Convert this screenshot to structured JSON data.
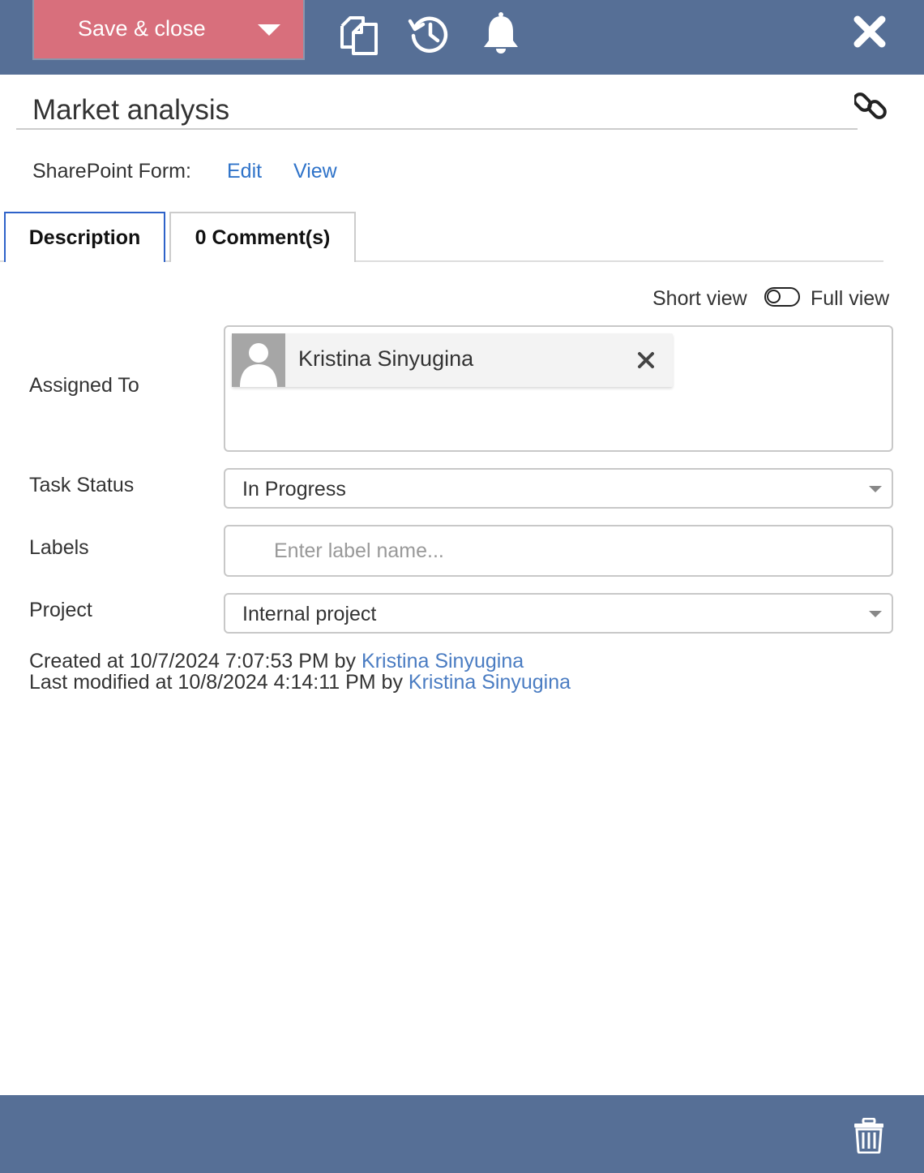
{
  "toolbar": {
    "save_label": "Save & close",
    "icons": [
      "copy-icon",
      "history-icon",
      "bell-icon",
      "close-icon"
    ]
  },
  "task": {
    "title": "Market analysis"
  },
  "sharepoint": {
    "label": "SharePoint Form:",
    "edit": "Edit",
    "view": "View"
  },
  "tabs": [
    {
      "label": "Description",
      "active": true
    },
    {
      "label": "0 Comment(s)",
      "active": false
    }
  ],
  "view_toggle": {
    "short": "Short view",
    "full": "Full view"
  },
  "fields": {
    "assigned_to": {
      "label": "Assigned To",
      "users": [
        "Kristina Sinyugina"
      ]
    },
    "task_status": {
      "label": "Task Status",
      "value": "In Progress"
    },
    "labels": {
      "label": "Labels",
      "placeholder": "Enter label name..."
    },
    "project": {
      "label": "Project",
      "value": "Internal project"
    }
  },
  "meta": {
    "created_prefix": "Created at 10/7/2024 7:07:53 PM by",
    "created_by": "Kristina Sinyugina",
    "modified_prefix": "Last modified at 10/8/2024 4:14:11 PM by",
    "modified_by": "Kristina Sinyugina"
  },
  "colors": {
    "toolbar_bg": "#566f96",
    "save_button": "#d86f7c",
    "link": "#2f73c9",
    "active_tab_border": "#2e62c9"
  }
}
